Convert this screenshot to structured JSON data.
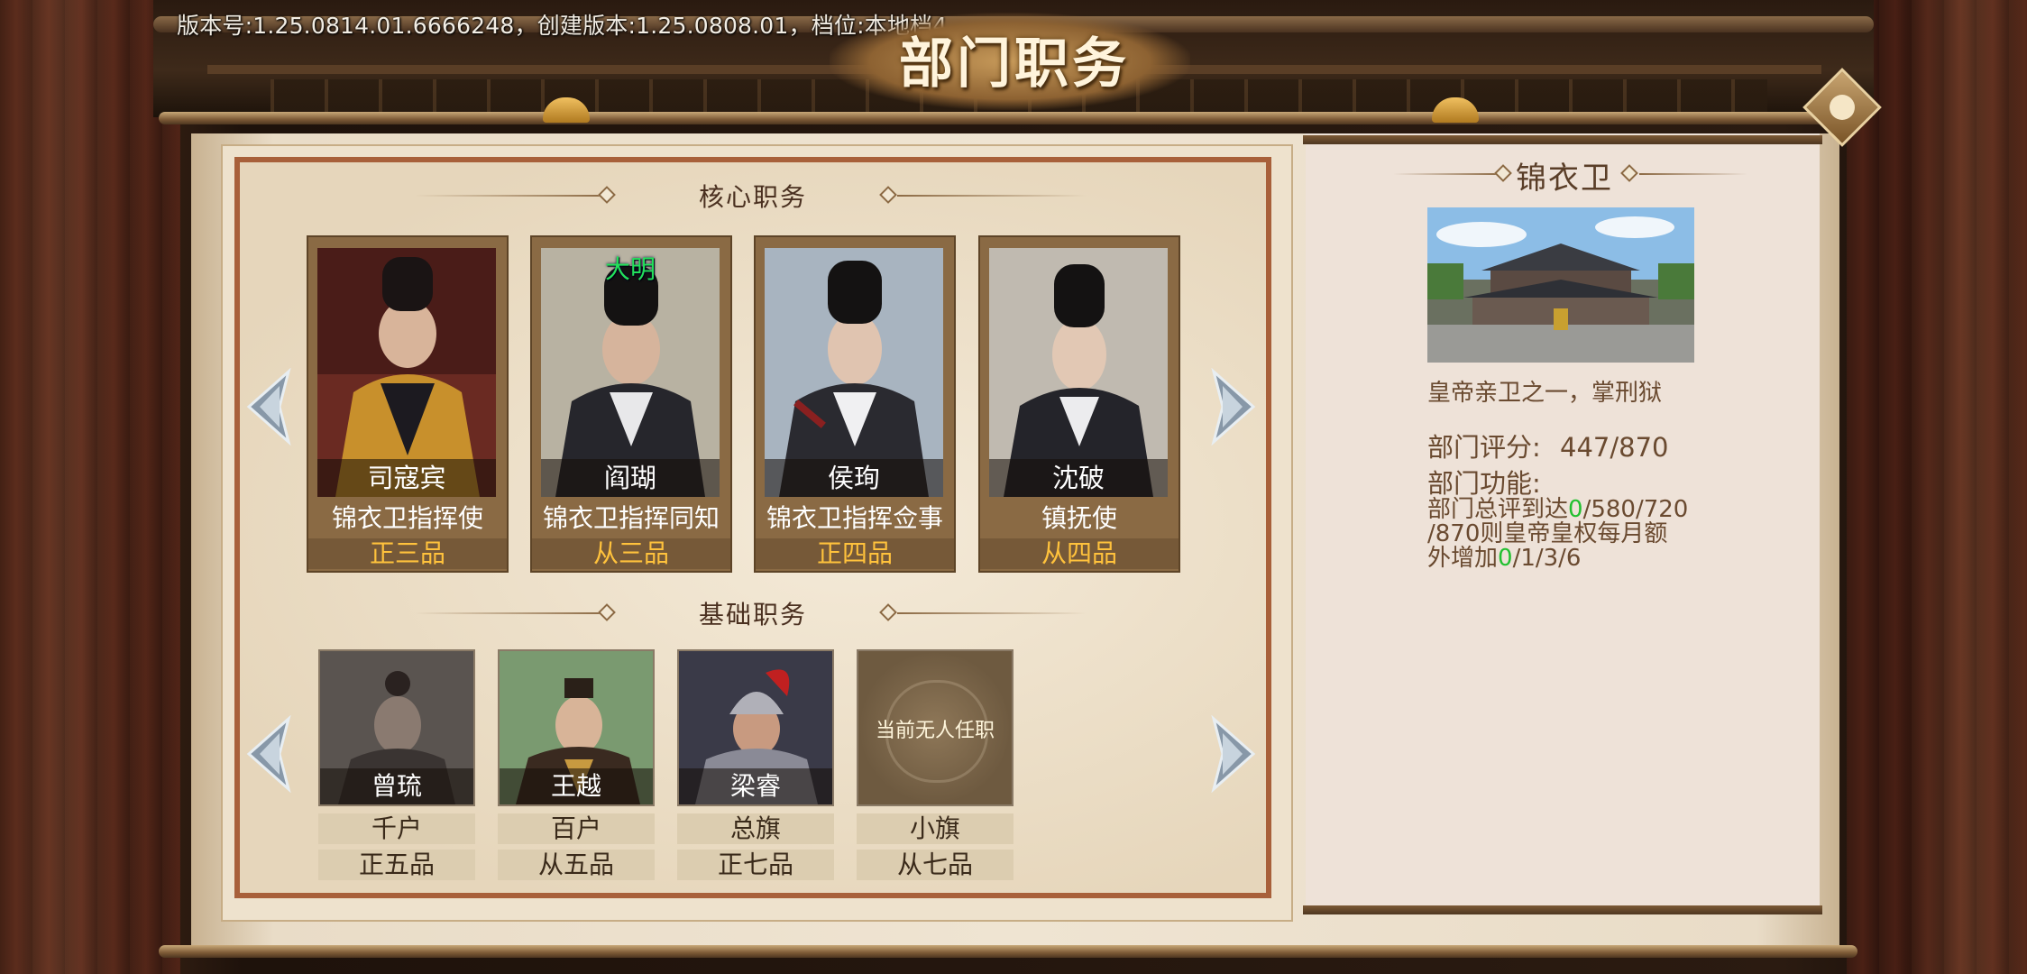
{
  "version_text": "版本号:1.25.0814.01.6666248，创建版本:1.25.0808.01，档位:本地档4",
  "title": "部门职务",
  "core_section": {
    "label": "核心职务",
    "cards": [
      {
        "name": "司寇宾",
        "post": "锦衣卫指挥使",
        "rank": "正三品",
        "country": ""
      },
      {
        "name": "阎瑚",
        "post": "锦衣卫指挥同知",
        "rank": "从三品",
        "country": "大明"
      },
      {
        "name": "侯珣",
        "post": "锦衣卫指挥佥事",
        "rank": "正四品",
        "country": ""
      },
      {
        "name": "沈破",
        "post": "镇抚使",
        "rank": "从四品",
        "country": ""
      }
    ]
  },
  "base_section": {
    "label": "基础职务",
    "cards": [
      {
        "name": "曾琉",
        "post": "千户",
        "rank": "正五品"
      },
      {
        "name": "王越",
        "post": "百户",
        "rank": "从五品"
      },
      {
        "name": "梁睿",
        "post": "总旗",
        "rank": "正七品"
      },
      {
        "name": "",
        "post": "小旗",
        "rank": "从七品",
        "empty_text": "当前无人任职"
      }
    ]
  },
  "department": {
    "name": "锦衣卫",
    "description": "皇帝亲卫之一，掌刑狱",
    "score_label": "部门评分:",
    "score_value": "447/870",
    "function_label": "部门功能:",
    "function_line1_a": "部门总评到达",
    "function_line1_hl": "0",
    "function_line1_b": "/580/720",
    "function_line2": "/870则皇帝皇权每月额",
    "function_line3_a": "外增加",
    "function_line3_hl": "0",
    "function_line3_b": "/1/3/6"
  },
  "colors": {
    "rank_gold": "#ffc23c",
    "country_green": "#23e05a",
    "highlight_green": "#22c030"
  },
  "icons": [
    "prev-arrow-icon",
    "next-arrow-icon",
    "close-icon"
  ]
}
